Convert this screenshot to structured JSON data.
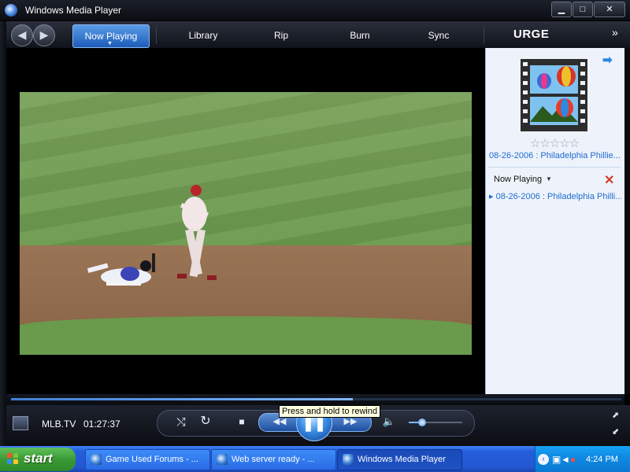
{
  "window": {
    "title": "Windows Media Player",
    "minimize": "▁",
    "maximize": "□",
    "close": "✕"
  },
  "nav": {
    "back": "◀",
    "forward": "▶",
    "tabs": [
      {
        "label": "Now Playing"
      },
      {
        "label": "Library"
      },
      {
        "label": "Rip"
      },
      {
        "label": "Burn"
      },
      {
        "label": "Sync"
      }
    ],
    "urge": "URGE",
    "more": "»"
  },
  "right_panel": {
    "next_arrow": "➡",
    "rating_stars": "☆☆☆☆☆",
    "album_title": "08-26-2006 : Philadelphia Phillie...",
    "now_playing_label": "Now Playing",
    "now_playing_caret": "▼",
    "remove": "✕",
    "playlist": [
      {
        "marker": "▸",
        "title": "08-26-2006 : Philadelphia Philli..."
      }
    ]
  },
  "player": {
    "source": "MLB.TV",
    "time": "01:27:37",
    "progress": 0.56,
    "volume": 0.25,
    "tooltip": "Press and hold to rewind",
    "controls": {
      "shuffle": "⤭",
      "repeat": "↻",
      "stop": "■",
      "rewind": "◀◀",
      "play_pause": "❚❚",
      "fast_forward": "▶▶",
      "volume": "🔈"
    },
    "mini_mode": "⬈",
    "fullscreen": "⬋"
  },
  "taskbar": {
    "start": "start",
    "tasks": [
      {
        "label": "Game Used Forums - ...",
        "active": false
      },
      {
        "label": "Web server ready - ...",
        "active": false
      },
      {
        "label": "Windows Media Player",
        "active": true
      }
    ],
    "tray_chevron": "‹",
    "clock": "4:24 PM"
  },
  "icons": [
    "wmp-logo-icon",
    "back-arrow-icon",
    "forward-arrow-icon",
    "next-arrow-icon",
    "star-icon",
    "remove-x-icon",
    "shuffle-icon",
    "repeat-icon",
    "stop-icon",
    "rewind-icon",
    "pause-icon",
    "fast-forward-icon",
    "volume-icon",
    "windows-logo-icon",
    "network-icon",
    "speaker-icon",
    "security-alert-icon"
  ],
  "colors": {
    "accent": "#1f6bd1",
    "tab_active": "#3d84dc",
    "taskbar": "#245edb",
    "start_green": "#3a9a34",
    "tooltip_bg": "#ffffe1"
  }
}
